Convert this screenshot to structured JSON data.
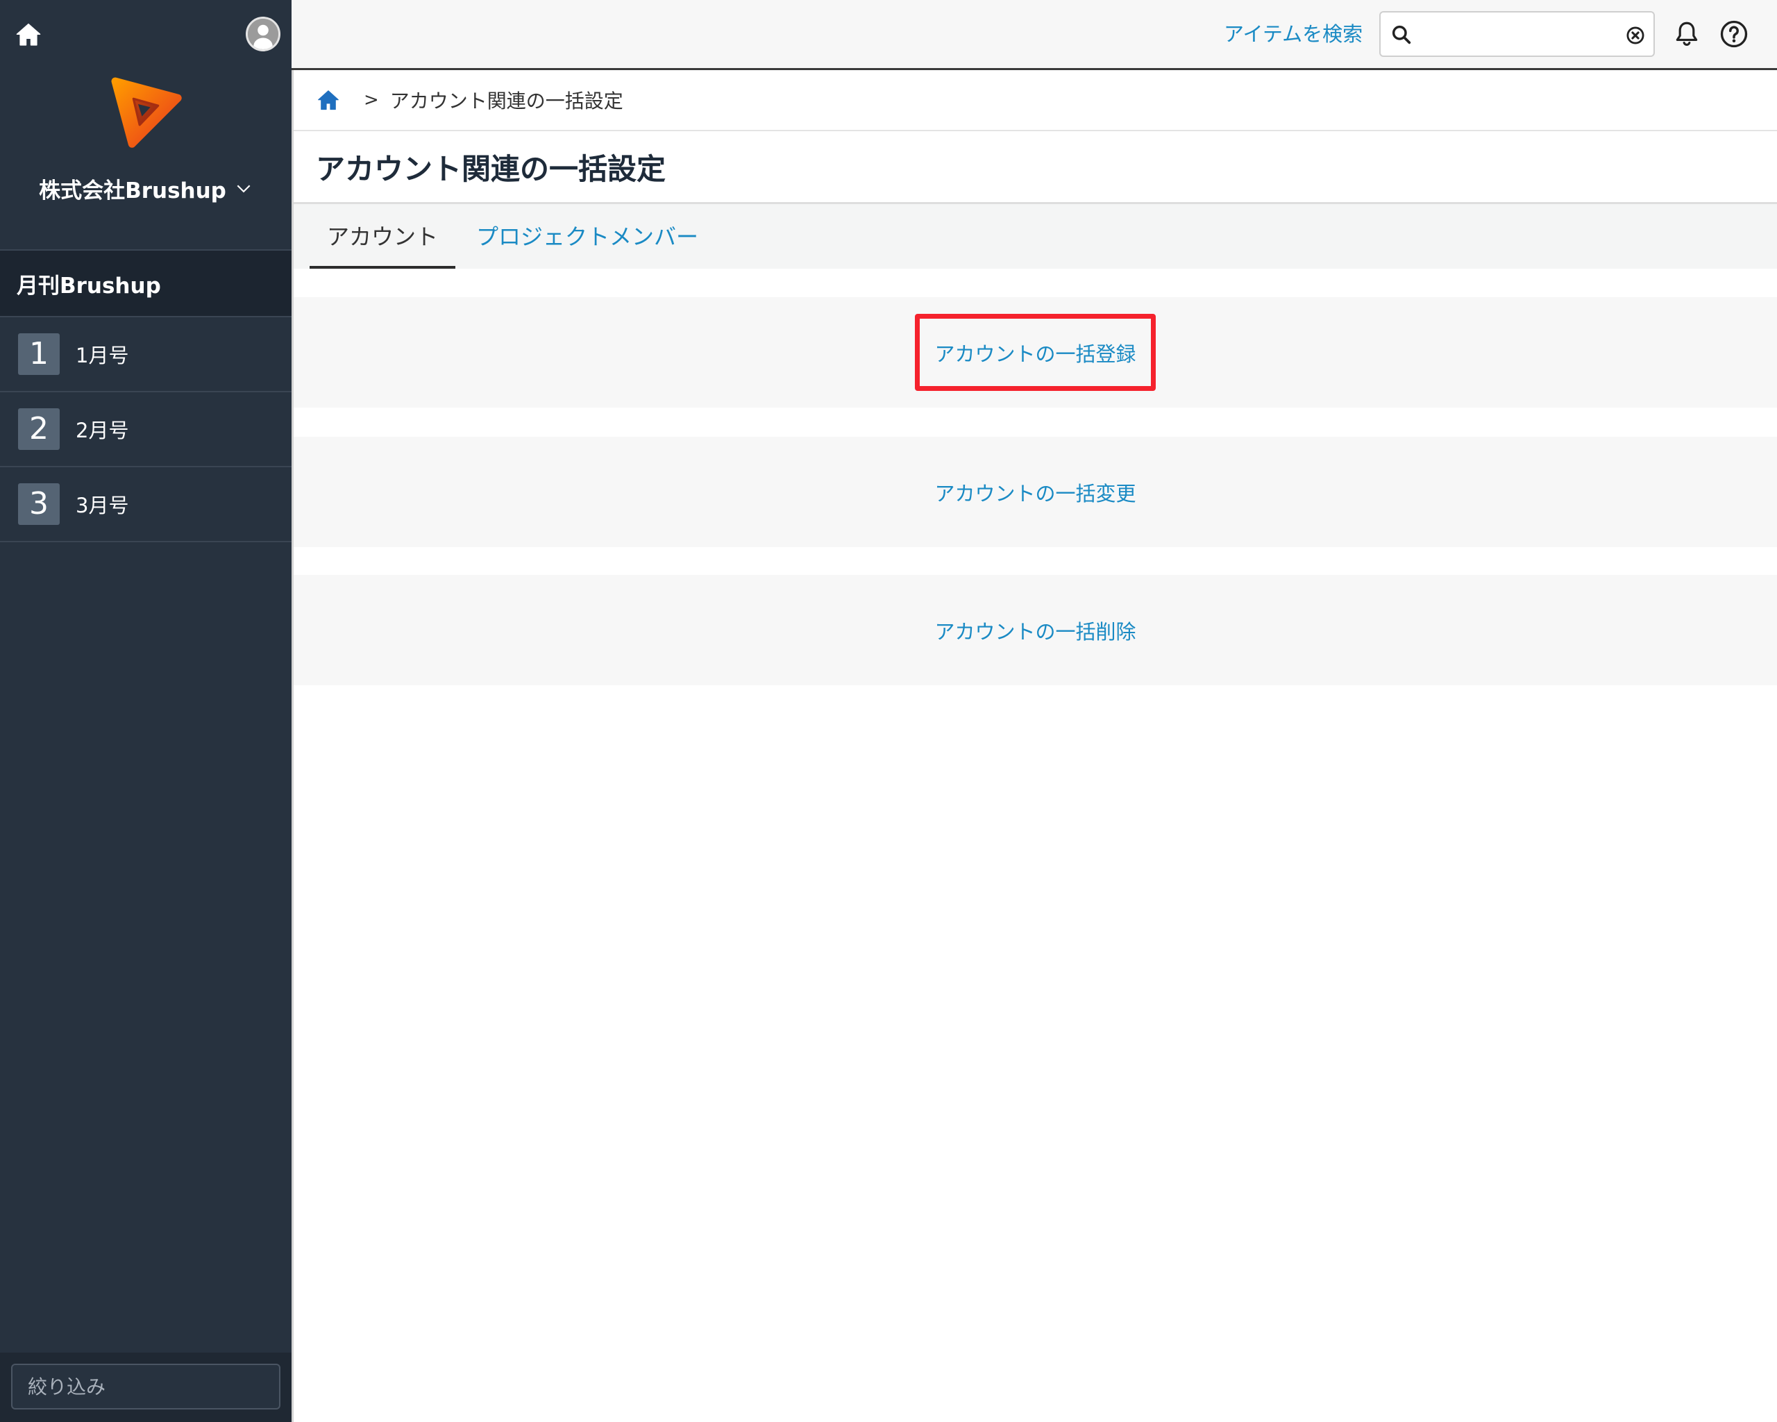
{
  "sidebar": {
    "company_name": "株式会社Brushup",
    "section_title": "月刊Brushup",
    "items": [
      {
        "number": "1",
        "label": "1月号"
      },
      {
        "number": "2",
        "label": "2月号"
      },
      {
        "number": "3",
        "label": "3月号"
      }
    ],
    "filter_placeholder": "絞り込み"
  },
  "header": {
    "search_link": "アイテムを検索"
  },
  "breadcrumb": {
    "separator": ">",
    "current": "アカウント関連の一括設定"
  },
  "page": {
    "title": "アカウント関連の一括設定",
    "tabs": [
      {
        "label": "アカウント",
        "active": true
      },
      {
        "label": "プロジェクトメンバー",
        "active": false
      }
    ],
    "actions": [
      {
        "label": "アカウントの一括登録",
        "highlighted": true
      },
      {
        "label": "アカウントの一括変更",
        "highlighted": false
      },
      {
        "label": "アカウントの一括削除",
        "highlighted": false
      }
    ]
  },
  "colors": {
    "sidebar_bg": "#27323f",
    "sidebar_dark": "#1c2530",
    "badge_bg": "#556474",
    "link": "#1a8ac4",
    "highlight": "#f5222d",
    "logo_start": "#ff9a00",
    "logo_end": "#e8391d",
    "breadcrumb_home": "#1f6fbf"
  },
  "icons": {
    "sidebar_home": "home-icon",
    "user": "avatar-icon",
    "logo": "brushup-logo",
    "company_menu": "chevron-down-icon",
    "search": "search-icon",
    "clear": "clear-icon",
    "notifications": "bell-icon",
    "help": "help-icon",
    "breadcrumb_home": "home-icon"
  }
}
